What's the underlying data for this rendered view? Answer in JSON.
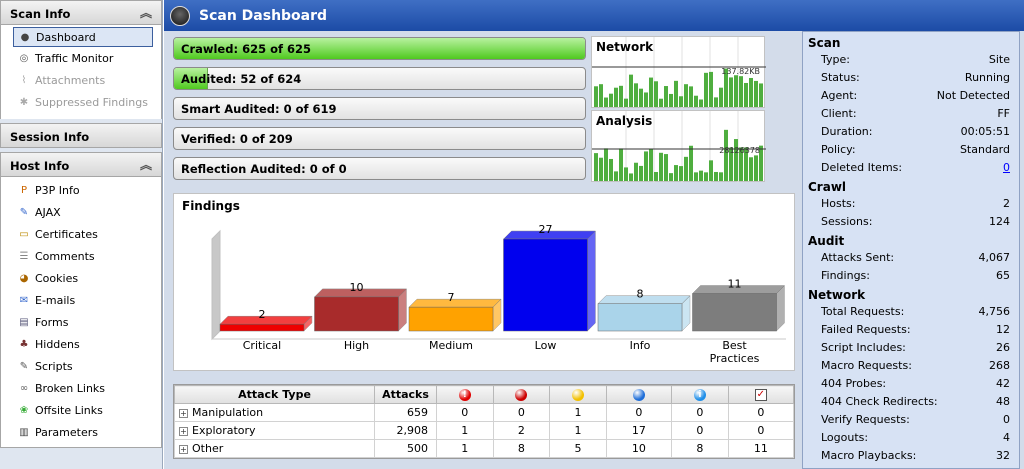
{
  "sidebar": {
    "scan_info": {
      "title": "Scan Info",
      "items": [
        {
          "label": "Dashboard",
          "icon": "dashboard-icon",
          "selected": true,
          "disabled": false
        },
        {
          "label": "Traffic Monitor",
          "icon": "traffic-monitor-icon",
          "selected": false,
          "disabled": false
        },
        {
          "label": "Attachments",
          "icon": "paperclip-icon",
          "selected": false,
          "disabled": true
        },
        {
          "label": "Suppressed Findings",
          "icon": "suppressed-icon",
          "selected": false,
          "disabled": true
        }
      ]
    },
    "session_info": {
      "title": "Session Info"
    },
    "host_info": {
      "title": "Host Info",
      "items": [
        {
          "label": "P3P Info",
          "icon": "p3p-icon"
        },
        {
          "label": "AJAX",
          "icon": "ajax-icon"
        },
        {
          "label": "Certificates",
          "icon": "certificate-icon"
        },
        {
          "label": "Comments",
          "icon": "comment-icon"
        },
        {
          "label": "Cookies",
          "icon": "cookie-icon"
        },
        {
          "label": "E-mails",
          "icon": "email-icon"
        },
        {
          "label": "Forms",
          "icon": "form-icon"
        },
        {
          "label": "Hiddens",
          "icon": "hidden-icon"
        },
        {
          "label": "Scripts",
          "icon": "script-icon"
        },
        {
          "label": "Broken Links",
          "icon": "broken-link-icon"
        },
        {
          "label": "Offsite Links",
          "icon": "offsite-link-icon"
        },
        {
          "label": "Parameters",
          "icon": "parameter-icon"
        }
      ]
    }
  },
  "header": {
    "title": "Scan Dashboard"
  },
  "progress": [
    {
      "label": "Crawled: 625 of 625",
      "fraction": 1.0
    },
    {
      "label": "Audited: 52 of 624",
      "fraction": 0.083
    },
    {
      "label": "Smart Audited: 0 of 619",
      "fraction": 0
    },
    {
      "label": "Verified: 0 of 209",
      "fraction": 0
    },
    {
      "label": "Reflection Audited: 0 of 0",
      "fraction": 0
    }
  ],
  "network_chart": {
    "title": "Network",
    "value_label": "137.82KB"
  },
  "analysis_chart": {
    "title": "Analysis",
    "value_label": "28126378"
  },
  "chart_data": [
    {
      "type": "bar",
      "title": "Findings",
      "categories": [
        "Critical",
        "High",
        "Medium",
        "Low",
        "Info",
        "Best Practices"
      ],
      "values": [
        2,
        10,
        7,
        27,
        8,
        11
      ],
      "colors": [
        "#ee0000",
        "#a82b2b",
        "#ffa200",
        "#0000ee",
        "#aad4ea",
        "#7d7d7d"
      ],
      "ylim": [
        0,
        27
      ]
    }
  ],
  "attack_table": {
    "headers": [
      "Attack Type",
      "Attacks"
    ],
    "severity_icons": [
      {
        "name": "critical-severity-icon",
        "color": "#e00000"
      },
      {
        "name": "high-severity-icon",
        "color": "#cc0000"
      },
      {
        "name": "medium-severity-icon",
        "color": "#f2c000"
      },
      {
        "name": "low-severity-icon",
        "color": "#1f6ed8"
      },
      {
        "name": "info-severity-icon",
        "color": "#1f8ee8"
      },
      {
        "name": "best-practice-icon",
        "color": "#cc0000"
      }
    ],
    "rows": [
      {
        "type": "Manipulation",
        "attacks": "659",
        "counts": [
          "0",
          "0",
          "1",
          "0",
          "0",
          "0"
        ]
      },
      {
        "type": "Exploratory",
        "attacks": "2,908",
        "counts": [
          "1",
          "2",
          "1",
          "17",
          "0",
          "0"
        ]
      },
      {
        "type": "Other",
        "attacks": "500",
        "counts": [
          "1",
          "8",
          "5",
          "10",
          "8",
          "11"
        ]
      }
    ]
  },
  "stats": {
    "scan": {
      "title": "Scan",
      "rows": [
        {
          "label": "Type:",
          "value": "Site"
        },
        {
          "label": "Status:",
          "value": "Running"
        },
        {
          "label": "Agent:",
          "value": "Not Detected"
        },
        {
          "label": "Client:",
          "value": "FF"
        },
        {
          "label": "Duration:",
          "value": "00:05:51"
        },
        {
          "label": "Policy:",
          "value": "Standard"
        },
        {
          "label": "Deleted Items:",
          "value": "0",
          "link": true
        }
      ]
    },
    "crawl": {
      "title": "Crawl",
      "rows": [
        {
          "label": "Hosts:",
          "value": "2"
        },
        {
          "label": "Sessions:",
          "value": "124"
        }
      ]
    },
    "audit": {
      "title": "Audit",
      "rows": [
        {
          "label": "Attacks Sent:",
          "value": "4,067"
        },
        {
          "label": "Findings:",
          "value": "65"
        }
      ]
    },
    "network": {
      "title": "Network",
      "rows": [
        {
          "label": "Total Requests:",
          "value": "4,756"
        },
        {
          "label": "Failed Requests:",
          "value": "12"
        },
        {
          "label": "Script Includes:",
          "value": "26"
        },
        {
          "label": "Macro Requests:",
          "value": "268"
        },
        {
          "label": "404 Probes:",
          "value": "42"
        },
        {
          "label": "404 Check Redirects:",
          "value": "48"
        },
        {
          "label": "Verify Requests:",
          "value": "0"
        },
        {
          "label": "Logouts:",
          "value": "4"
        },
        {
          "label": "Macro Playbacks:",
          "value": "32"
        }
      ]
    }
  }
}
